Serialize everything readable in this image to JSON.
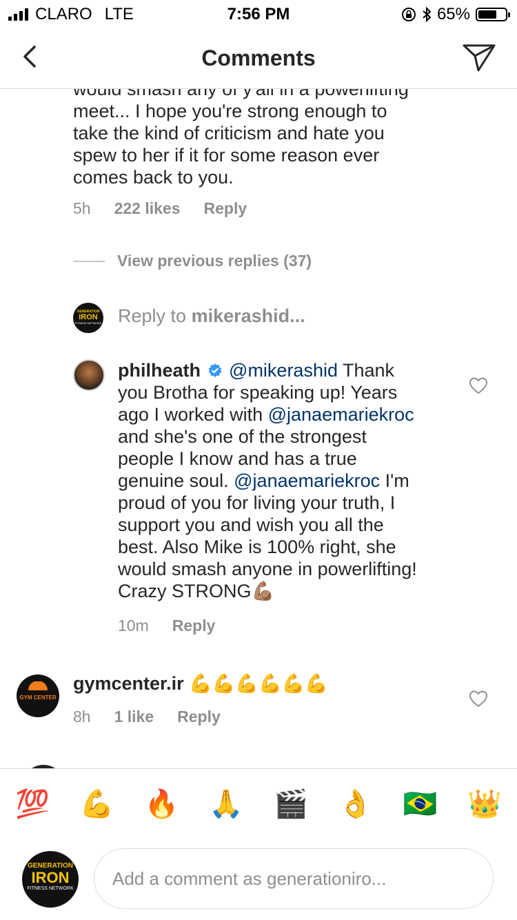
{
  "status_bar": {
    "carrier": "CLARO",
    "network": "LTE",
    "time": "7:56 PM",
    "battery": "65%",
    "battery_level": 0.65
  },
  "header": {
    "title": "Comments",
    "back_icon": "chevron-left-icon",
    "send_icon": "paper-plane-icon"
  },
  "top_comment": {
    "text_lines": [
      "would smash any of y'all in a powerlifting",
      "meet... I hope you're strong enough to",
      "take the kind of criticism and hate you",
      "spew to her if it for some reason ever",
      "comes back to you."
    ],
    "time": "5h",
    "likes": "222 likes",
    "reply": "Reply"
  },
  "view_previous": "View previous replies (37)",
  "reply_to": {
    "prefix": "Reply to ",
    "user": "mikerashid...",
    "avatar_lines": [
      "GENERATION",
      "IRON",
      "FITNESS NETWORK"
    ]
  },
  "reply_comment": {
    "username": "philheath",
    "mention1": "@mikerashid",
    "t1": " Thank",
    "t2": "you Brotha  for speaking up! Years",
    "t3": "ago I worked with ",
    "mention2": "@janaemariekroc",
    "t4": "and she's one of the strongest",
    "t5": "people I know and has a true",
    "t6": "genuine soul. ",
    "mention3": "@janaemariekroc",
    "t6b": " I'm",
    "t7": "proud of you for living your truth, I",
    "t8": "support you and wish you all the",
    "t9": "best. Also Mike is 100% right, she",
    "t10": "would smash anyone in powerlifting!",
    "t11": "Crazy STRONG💪🏽",
    "time": "10m",
    "reply": "Reply"
  },
  "gym_comment": {
    "username": "gymcenter.ir",
    "text": "💪💪💪💪💪💪",
    "avatar_text": "GYM CENTER",
    "time": "8h",
    "likes": "1 like",
    "reply": "Reply"
  },
  "emoji_bar": [
    "💯",
    "💪",
    "🔥",
    "🙏",
    "🎬",
    "👌",
    "🇧🇷",
    "👑"
  ],
  "composer": {
    "placeholder": "Add a comment as generationiro...",
    "avatar_lines": [
      "GENERATION",
      "IRON",
      "FITNESS NETWORK"
    ]
  },
  "colors": {
    "mention": "#003569",
    "secondary_text": "#8e8e8e",
    "verified": "#3897f0",
    "divider": "#dbdbdb"
  }
}
